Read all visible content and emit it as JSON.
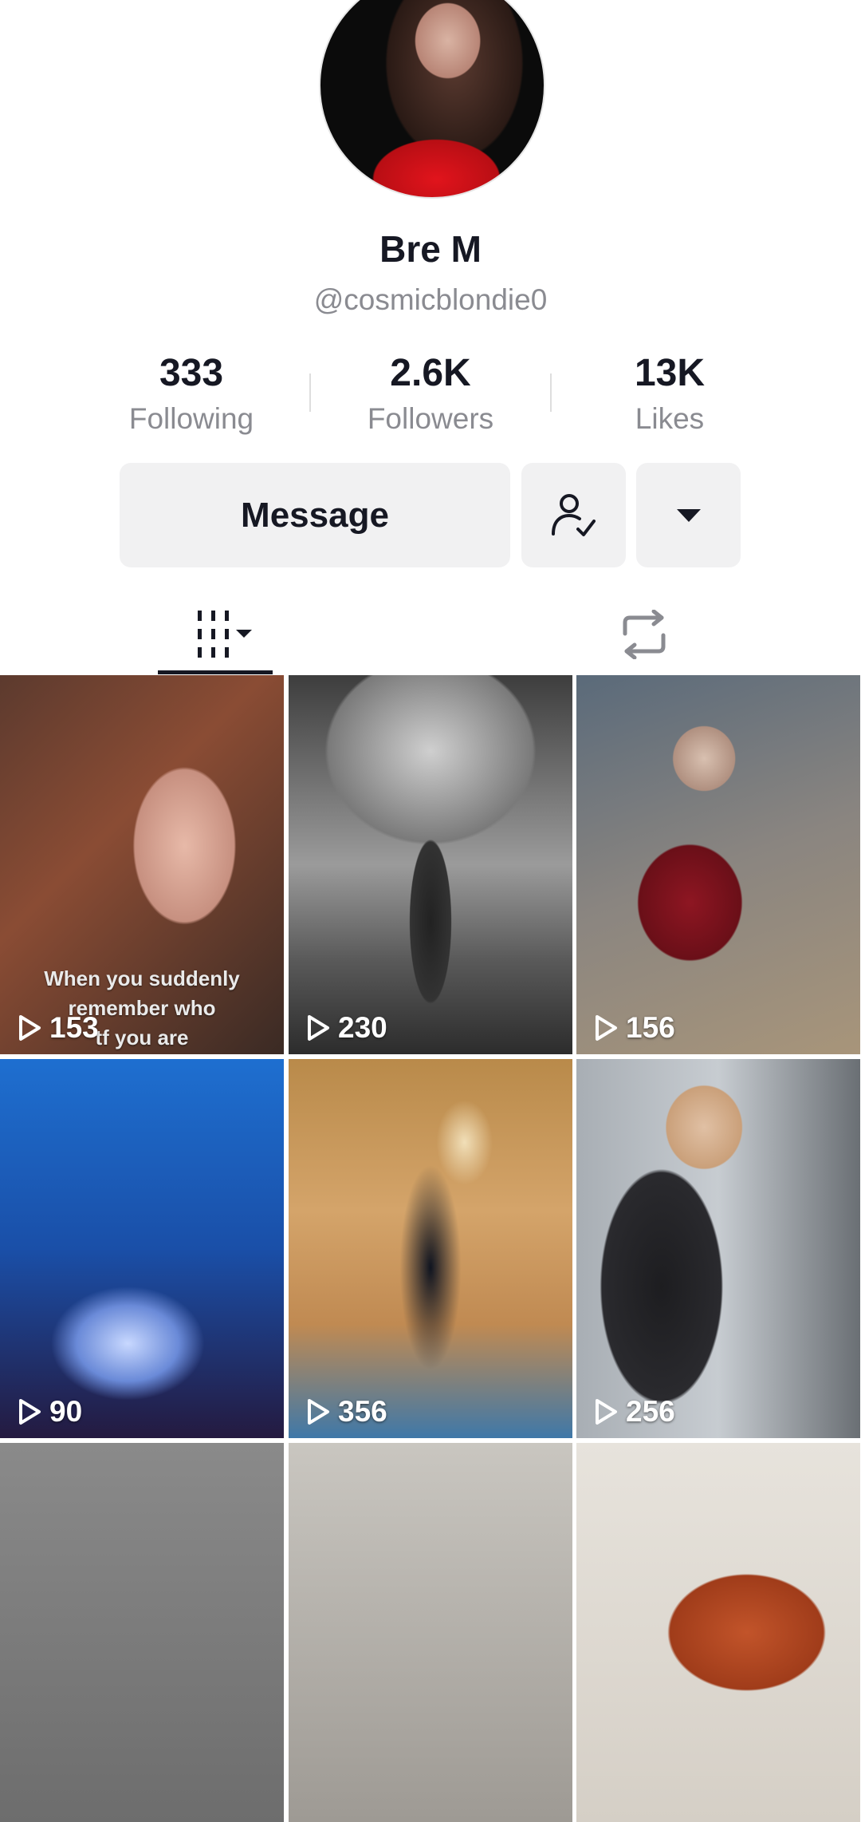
{
  "profile": {
    "name": "Bre M",
    "handle": "@cosmicblondie0"
  },
  "stats": [
    {
      "value": "333",
      "label": "Following"
    },
    {
      "value": "2.6K",
      "label": "Followers"
    },
    {
      "value": "13K",
      "label": "Likes"
    }
  ],
  "actions": {
    "message_label": "Message",
    "follow_icon": "person-check-icon",
    "more_icon": "caret-down-icon"
  },
  "tabs": {
    "videos_icon": "grid-icon",
    "reposts_icon": "repost-icon"
  },
  "videos": [
    {
      "views": "153",
      "overlay_text": [
        "When you suddenly",
        "remember who",
        "tf you are"
      ]
    },
    {
      "views": "230"
    },
    {
      "views": "156"
    },
    {
      "views": "90"
    },
    {
      "views": "356"
    },
    {
      "views": "256"
    }
  ]
}
